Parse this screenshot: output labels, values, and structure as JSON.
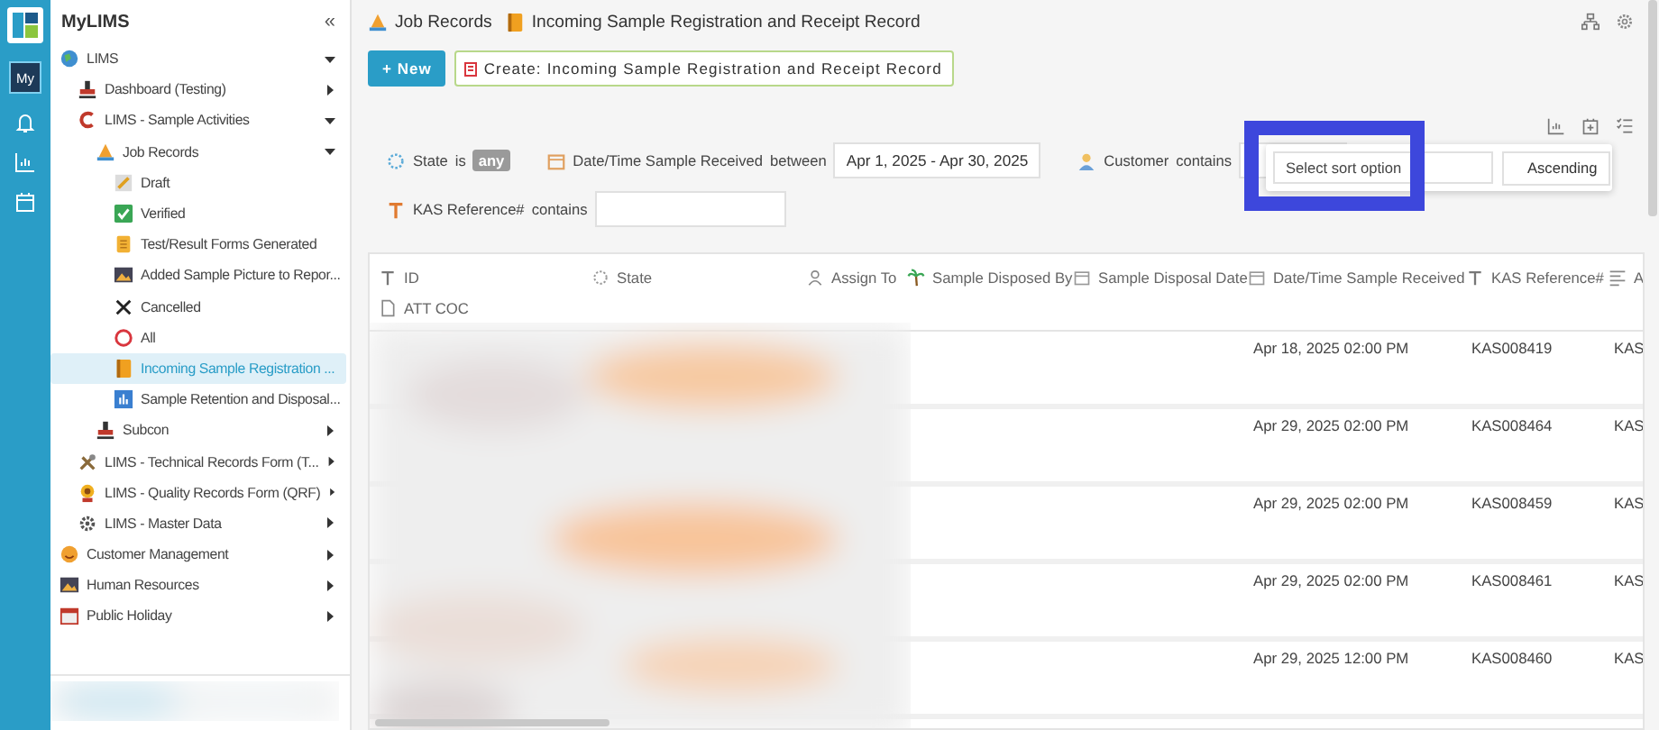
{
  "app": {
    "title": "MyLIMS",
    "rail_badge": "My"
  },
  "sidebar": {
    "collapse": "«",
    "items": [
      {
        "label": "LIMS",
        "kind": "globe",
        "expanded": true,
        "selected": false,
        "children": [
          {
            "label": "Dashboard (Testing)",
            "kind": "stamp",
            "expanded": false,
            "selected": false
          },
          {
            "label": "LIMS - Sample Activities",
            "kind": "swirl",
            "expanded": true,
            "selected": false,
            "children": [
              {
                "label": "Job Records",
                "kind": "cone",
                "expanded": true,
                "selected": false,
                "children": [
                  {
                    "label": "Draft",
                    "kind": "note",
                    "selected": false
                  },
                  {
                    "label": "Verified",
                    "kind": "check",
                    "selected": false
                  },
                  {
                    "label": "Test/Result Forms Generated",
                    "kind": "scroll",
                    "selected": false
                  },
                  {
                    "label": "Added Sample Picture to Repor...",
                    "kind": "photo",
                    "selected": false
                  },
                  {
                    "label": "Cancelled",
                    "kind": "cross",
                    "selected": false
                  },
                  {
                    "label": "All",
                    "kind": "ring",
                    "selected": false
                  },
                  {
                    "label": "Incoming Sample Registration ...",
                    "kind": "book",
                    "selected": true
                  },
                  {
                    "label": "Sample Retention and Disposal...",
                    "kind": "chart",
                    "selected": false
                  }
                ]
              },
              {
                "label": "Subcon",
                "kind": "stamp",
                "expanded": false,
                "selected": false
              }
            ]
          },
          {
            "label": "LIMS - Technical Records Form (T...",
            "kind": "tools",
            "expanded": false,
            "selected": false
          },
          {
            "label": "LIMS - Quality Records Form (QRF)",
            "kind": "flower",
            "expanded": false,
            "selected": false
          },
          {
            "label": "LIMS - Master Data",
            "kind": "gear",
            "expanded": false,
            "selected": false
          }
        ]
      },
      {
        "label": "Customer Management",
        "kind": "smiley",
        "expanded": false,
        "selected": false
      },
      {
        "label": "Human Resources",
        "kind": "photo",
        "expanded": false,
        "selected": false
      },
      {
        "label": "Public Holiday",
        "kind": "calendar",
        "expanded": false,
        "selected": false
      }
    ]
  },
  "breadcrumb": [
    {
      "label": "Job Records",
      "kind": "cone"
    },
    {
      "label": "Incoming Sample Registration and Receipt Record",
      "kind": "book"
    }
  ],
  "buttons": {
    "new": "+ New",
    "create": "Create: Incoming Sample Registration and Receipt Record"
  },
  "filter_rows": [
    [
      {
        "label": "State",
        "kind": "state",
        "operator": "is",
        "badge": "any"
      },
      {
        "label": "Date/Time Sample Received",
        "kind": "date",
        "operator": "between",
        "value": "Apr 1, 2025 - Apr 30, 2025"
      },
      {
        "label": "Customer",
        "kind": "person",
        "operator": "contains"
      }
    ],
    [
      {
        "label": "KAS Reference#",
        "kind": "text",
        "operator": "contains"
      }
    ]
  ],
  "sort_popup": {
    "placeholder": "Select sort option",
    "direction": "Ascending"
  },
  "table": {
    "columns": [
      {
        "label": "ID",
        "kind": "text"
      },
      {
        "label": "State",
        "kind": "state"
      },
      {
        "label": "Assign To",
        "kind": "person"
      },
      {
        "label": "Sample Disposed By",
        "kind": "palm"
      },
      {
        "label": "Sample Disposal Date",
        "kind": "date"
      },
      {
        "label": "Date/Time Sample Received",
        "kind": "date"
      },
      {
        "label": "KAS Reference#",
        "kind": "text"
      },
      {
        "label": "A",
        "kind": "lines"
      },
      {
        "label": "ATT COC",
        "kind": "file"
      }
    ],
    "rows": [
      {
        "received": "Apr 18, 2025 02:00 PM",
        "reference": "KAS008419",
        "column_8": "KAS"
      },
      {
        "received": "Apr 29, 2025 02:00 PM",
        "reference": "KAS008464",
        "column_8": "KAS"
      },
      {
        "received": "Apr 29, 2025 02:00 PM",
        "reference": "KAS008459",
        "column_8": "KAS"
      },
      {
        "received": "Apr 29, 2025 02:00 PM",
        "reference": "KAS008461",
        "column_8": "KAS"
      },
      {
        "received": "Apr 29, 2025 12:00 PM",
        "reference": "KAS008460",
        "column_8": "KAS"
      }
    ]
  }
}
